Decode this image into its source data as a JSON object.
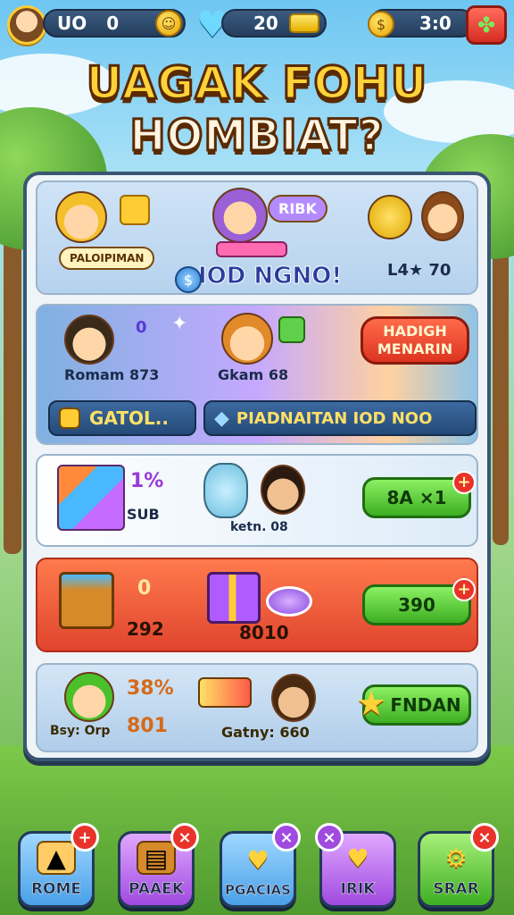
{
  "topbar": {
    "left_value": "UO",
    "left_count": "0",
    "gems": "20",
    "right_value": "3:0"
  },
  "title": {
    "line1": "UAGAK FOHU",
    "line2": "HOMBIAT?"
  },
  "card1": {
    "name_pill": "PALOIPIMAN",
    "sign": "RIBK",
    "headline": "IOD NGNO!",
    "stat": "L4★ 70"
  },
  "card2": {
    "left_name": "Romam 873",
    "left_num": "0",
    "mid_name": "Gkam 68",
    "red_button": "HADIGH MENARIN",
    "btn_left": "GATOL..",
    "btn_right": "PIADNAITAN IOD NOO"
  },
  "card3": {
    "percent": "1%",
    "sub": "SUB",
    "mid_label": "ketn. 08",
    "button": "8A ×1"
  },
  "card4": {
    "count": "0",
    "value": "292",
    "mid_value": "8010",
    "button": "390"
  },
  "card5": {
    "percent": "38%",
    "left_label": "Bsy: Orp",
    "left_value": "801",
    "mid_label": "Gatny: 660",
    "button": "FNDAN"
  },
  "nav": [
    {
      "label": "ROME",
      "badge": "+",
      "icon": "map-icon"
    },
    {
      "label": "PAAEK",
      "badge": "×",
      "icon": "book-icon"
    },
    {
      "label": "PGACIAS",
      "badge": "×",
      "icon": "heart-icon"
    },
    {
      "label": "IRIK",
      "badge": "×",
      "icon": "heart-icon"
    },
    {
      "label": "SRAR",
      "badge": "×",
      "icon": "gear-icon"
    }
  ],
  "colors": {
    "accent": "#ffd23a",
    "panel_border": "#3a5674",
    "green": "#3dae22",
    "red": "#e0452e"
  }
}
